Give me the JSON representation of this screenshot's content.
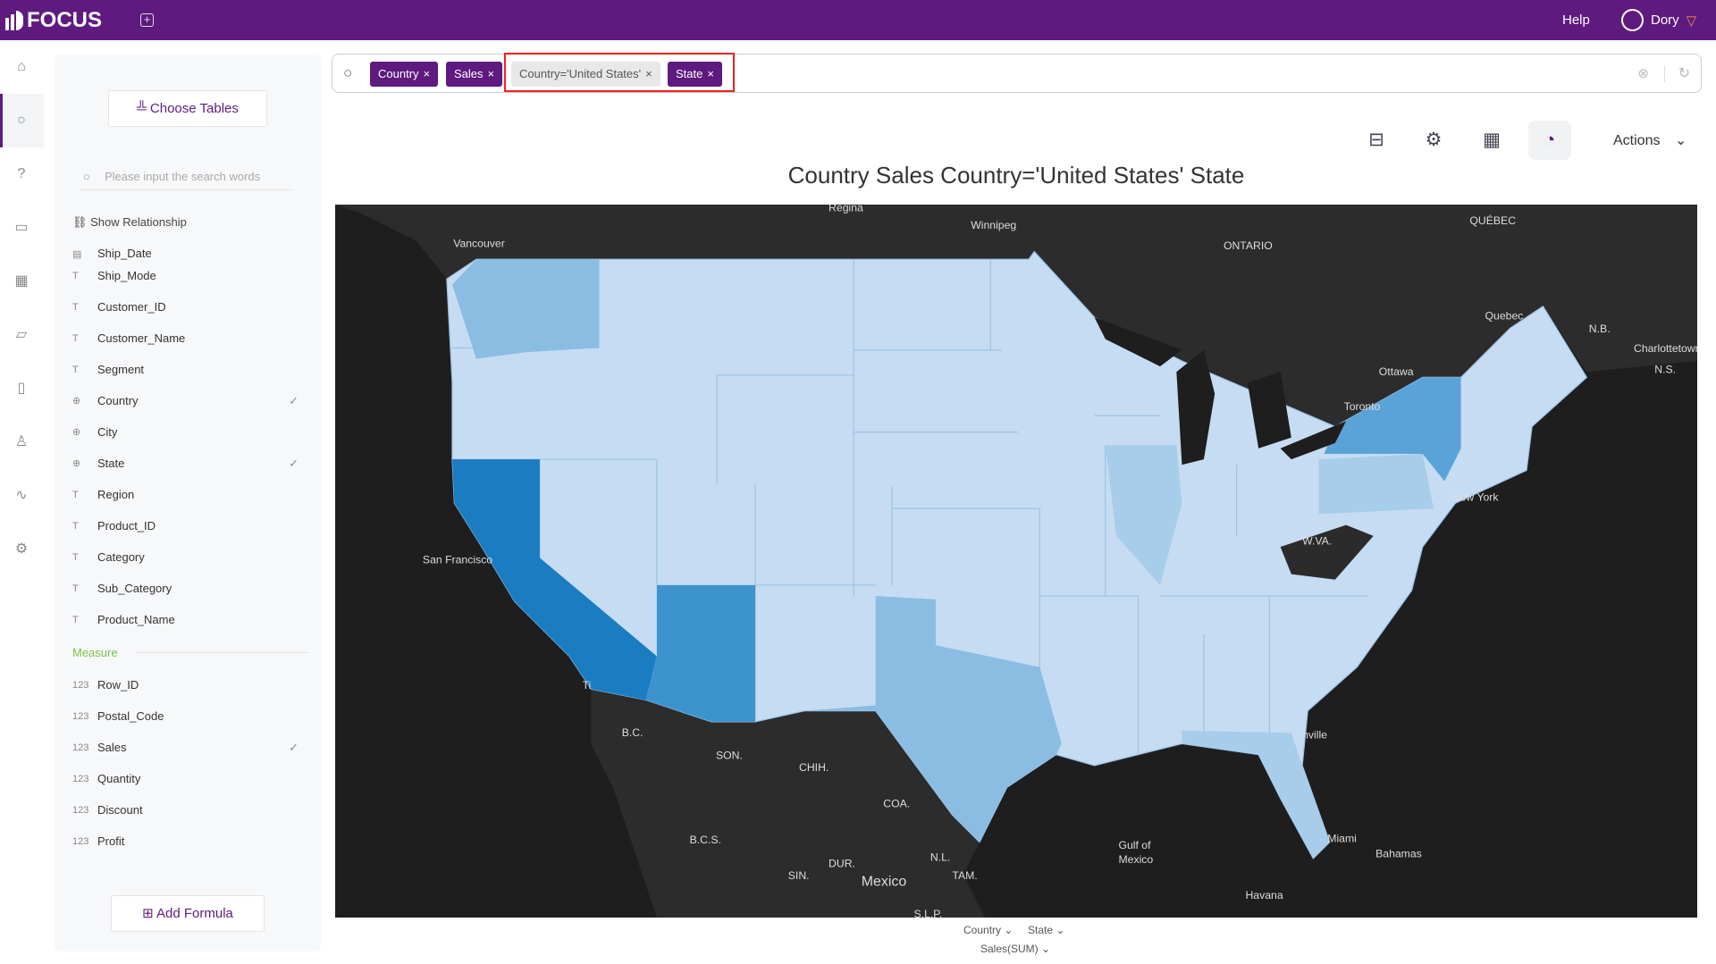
{
  "app": {
    "name": "FOCUS",
    "help": "Help",
    "user": "Dory"
  },
  "sidebar": {
    "choose_tables": "Choose Tables",
    "search_placeholder": "Please input the search words",
    "show_relationship": "Show Relationship",
    "dimensions": [
      {
        "label": "Ship_Date",
        "type": "date",
        "checked": false
      },
      {
        "label": "Ship_Mode",
        "type": "text",
        "checked": false
      },
      {
        "label": "Customer_ID",
        "type": "text",
        "checked": false
      },
      {
        "label": "Customer_Name",
        "type": "text",
        "checked": false
      },
      {
        "label": "Segment",
        "type": "text",
        "checked": false
      },
      {
        "label": "Country",
        "type": "geo",
        "checked": true
      },
      {
        "label": "City",
        "type": "geo",
        "checked": false
      },
      {
        "label": "State",
        "type": "geo",
        "checked": true
      },
      {
        "label": "Region",
        "type": "text",
        "checked": false
      },
      {
        "label": "Product_ID",
        "type": "text",
        "checked": false
      },
      {
        "label": "Category",
        "type": "text",
        "checked": false
      },
      {
        "label": "Sub_Category",
        "type": "text",
        "checked": false
      },
      {
        "label": "Product_Name",
        "type": "text",
        "checked": false
      }
    ],
    "measure_label": "Measure",
    "measures": [
      {
        "label": "Row_ID",
        "checked": false
      },
      {
        "label": "Postal_Code",
        "checked": false
      },
      {
        "label": "Sales",
        "checked": true
      },
      {
        "label": "Quantity",
        "checked": false
      },
      {
        "label": "Discount",
        "checked": false
      },
      {
        "label": "Profit",
        "checked": false
      }
    ],
    "add_formula": "Add Formula"
  },
  "search": {
    "tokens": [
      {
        "label": "Country",
        "kind": "column"
      },
      {
        "label": "Sales",
        "kind": "column"
      },
      {
        "label": "Country='United States'",
        "kind": "filter"
      },
      {
        "label": "State",
        "kind": "column"
      }
    ]
  },
  "toolbar": {
    "actions": "Actions"
  },
  "chart": {
    "title": "Country Sales Country='United States' State",
    "axis_labels": {
      "country": "Country",
      "state": "State",
      "value": "Sales(SUM)"
    },
    "map_labels": [
      "Regina",
      "Winnipeg",
      "Vancouver",
      "ONTARIO",
      "QUÉBEC",
      "Quebec",
      "N.B.",
      "Charlottetown",
      "N.S.",
      "Ottawa",
      "Toronto",
      "New York",
      "San Francisco",
      "W.VA.",
      "Ti",
      "B.C.",
      "SON.",
      "CHIH.",
      "COA.",
      "B.C.S.",
      "N.L.",
      "SIN.",
      "DUR.",
      "TAM.",
      "Mexico",
      "S.L.P.",
      "Gulf of",
      "Mexico",
      "Bahamas",
      "Miami",
      "Havana",
      "nville"
    ]
  },
  "colors": {
    "brand": "#5e1a7f",
    "highest": "#1a7cc1",
    "high": "#3d93cd",
    "mid": "#5aa3d8",
    "lowmid": "#8bbde3",
    "low": "#c6dcf2"
  }
}
